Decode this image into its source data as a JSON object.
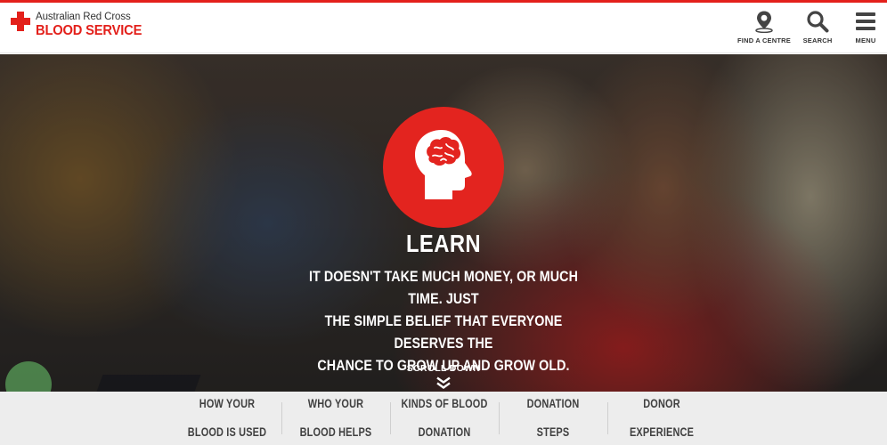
{
  "logo": {
    "line1": "Australian Red Cross",
    "line2": "BLOOD SERVICE",
    "brand_color": "#e3201b"
  },
  "header_tools": [
    {
      "label": "FIND A CENTRE",
      "icon": "location-pin-icon"
    },
    {
      "label": "SEARCH",
      "icon": "search-icon"
    },
    {
      "label": "MENU",
      "icon": "hamburger-menu-icon"
    }
  ],
  "hero": {
    "icon": "brain-head-icon",
    "icon_bg": "#e3241f",
    "title": "LEARN",
    "text_line1": "IT DOESN'T TAKE MUCH MONEY, OR MUCH TIME. JUST",
    "text_line2": "THE SIMPLE BELIEF THAT EVERYONE DESERVES THE",
    "text_line3": "CHANCE TO GROW UP AND GROW OLD.",
    "scroll_label": "SCROLL DOWN",
    "scroll_icon": "double-chevron-down-icon"
  },
  "sub_nav": [
    {
      "line1": "HOW YOUR",
      "line2": "BLOOD IS USED"
    },
    {
      "line1": "WHO YOUR",
      "line2": "BLOOD HELPS"
    },
    {
      "line1": "KINDS OF BLOOD",
      "line2": "DONATION"
    },
    {
      "line1": "DONATION",
      "line2": "STEPS"
    },
    {
      "line1": "DONOR",
      "line2": "EXPERIENCE"
    }
  ]
}
